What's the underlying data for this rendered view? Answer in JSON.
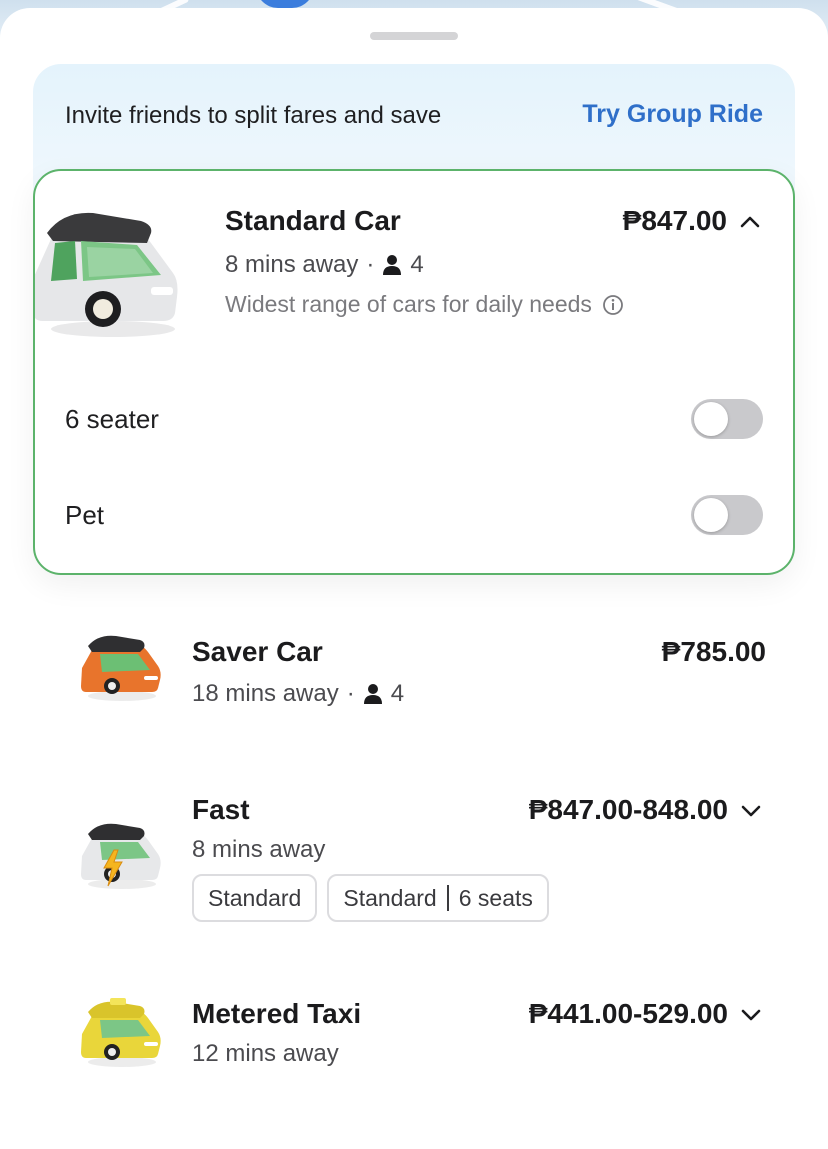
{
  "colors": {
    "accent_link": "#2f6fc9",
    "selected_border": "#5cb36b",
    "toggle_off": "#c9c9cc"
  },
  "promo": {
    "text": "Invite friends to split fares and save",
    "link": "Try Group Ride"
  },
  "selected_ride": {
    "name": "Standard Car",
    "eta": "8 mins away",
    "separator": "·",
    "seats": "4",
    "description": "Widest range of cars for daily needs",
    "price": "₱847.00",
    "chevron": "chevron-up-icon",
    "options": [
      {
        "label": "6 seater",
        "enabled": false
      },
      {
        "label": "Pet",
        "enabled": false
      }
    ]
  },
  "rides": [
    {
      "name": "Saver Car",
      "eta": "18 mins away",
      "separator": "·",
      "seats": "4",
      "price": "₱785.00",
      "icon": "orange-car-icon"
    },
    {
      "name": "Fast",
      "eta": "8 mins away",
      "price": "₱847.00-848.00",
      "icon": "electric-car-icon",
      "chips": [
        {
          "label": "Standard"
        },
        {
          "label_a": "Standard",
          "label_b": "6 seats"
        }
      ]
    },
    {
      "name": "Metered Taxi",
      "eta": "12 mins away",
      "price": "₱441.00-529.00",
      "icon": "taxi-icon"
    }
  ]
}
